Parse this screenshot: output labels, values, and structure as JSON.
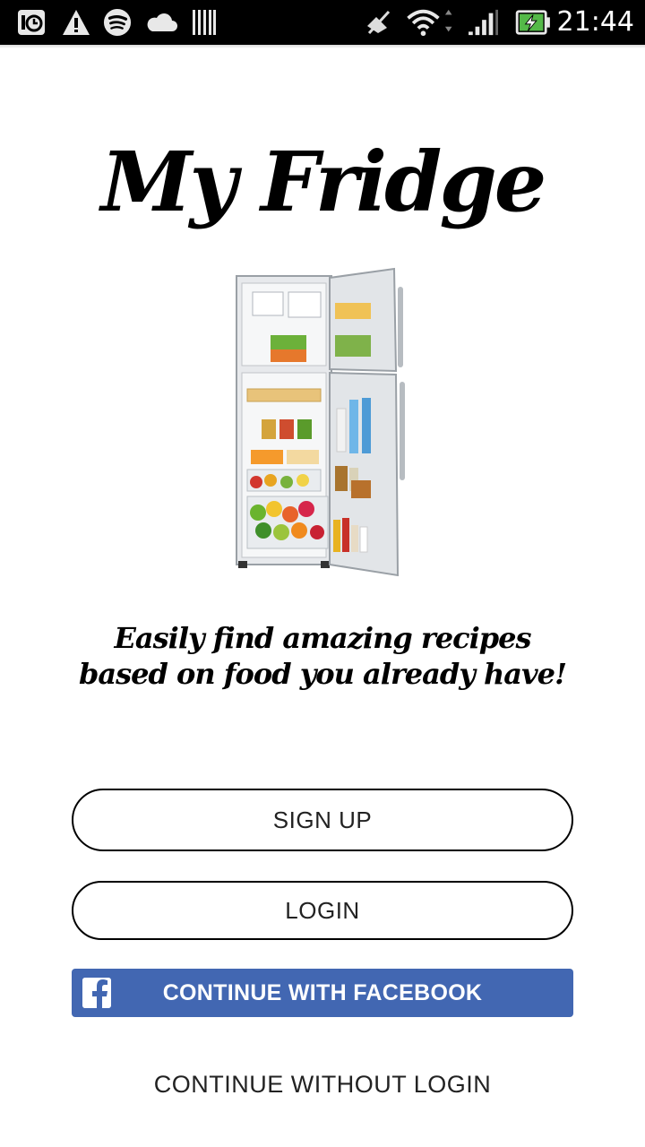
{
  "status_bar": {
    "time": "21:44",
    "icons": [
      "clock-alarm-icon",
      "warning-icon",
      "spotify-icon",
      "cloud-icon",
      "barcode-icon",
      "mute-icon",
      "wifi-icon",
      "signal-icon",
      "battery-charging-icon"
    ]
  },
  "app": {
    "title": "My Fridge",
    "tagline_line1": "Easily find amazing recipes",
    "tagline_line2": "based on food you already have!"
  },
  "buttons": {
    "signup": "SIGN UP",
    "login": "LOGIN",
    "facebook": "CONTINUE WITH FACEBOOK",
    "skip": "CONTINUE WITHOUT LOGIN"
  },
  "colors": {
    "facebook": "#4267b2",
    "status_bar": "#000000",
    "background": "#ffffff"
  }
}
